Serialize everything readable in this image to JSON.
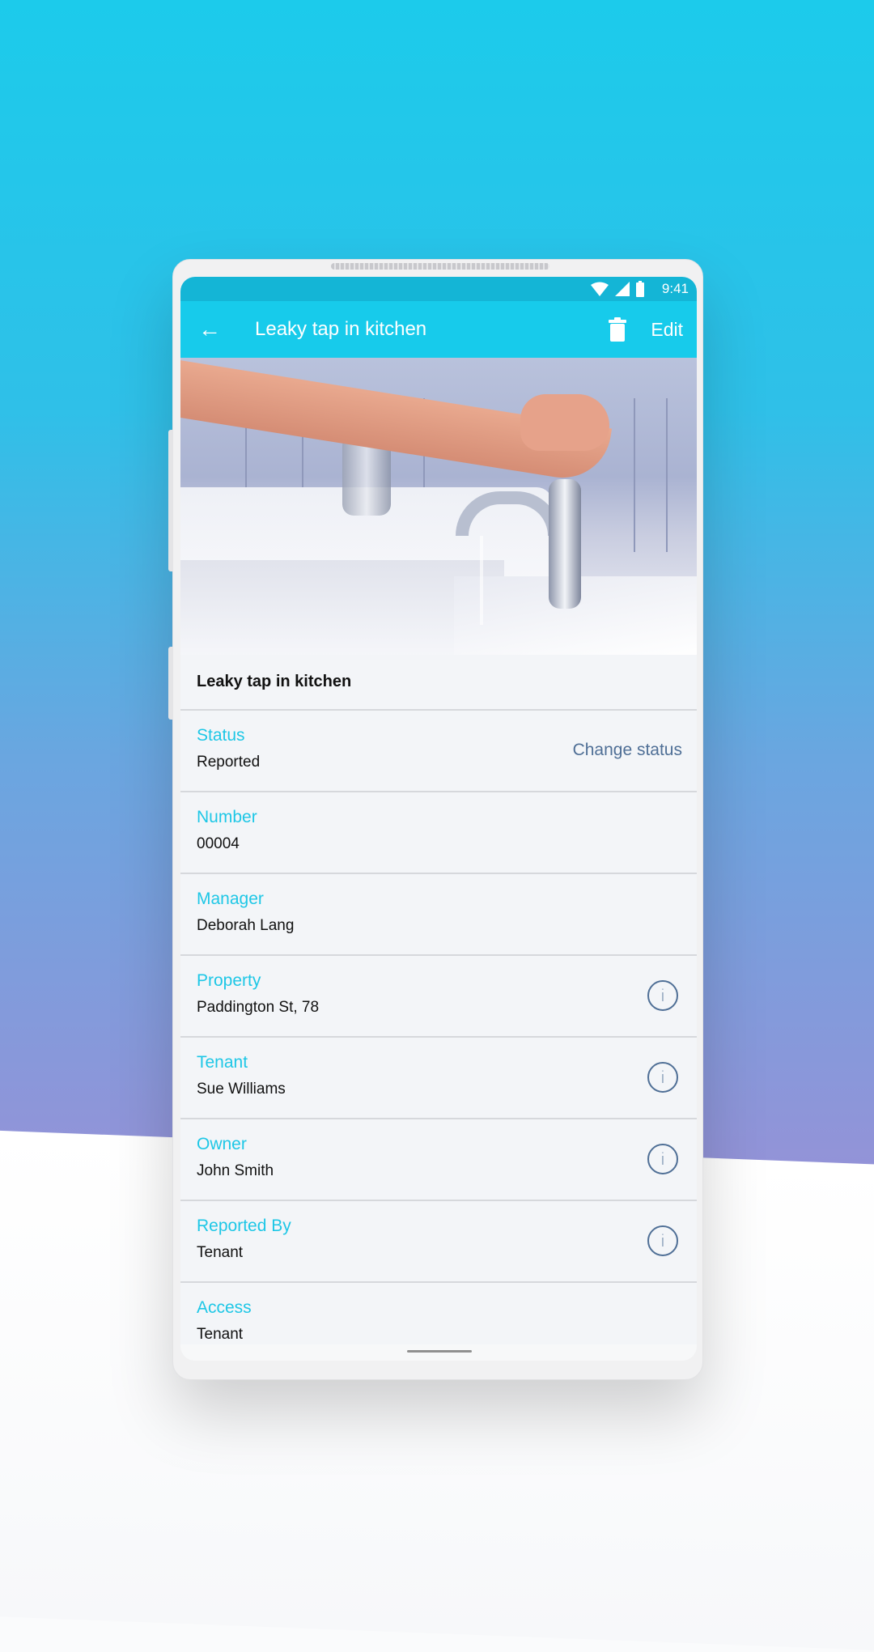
{
  "status_bar": {
    "time": "9:41"
  },
  "app_bar": {
    "title": "Leaky tap in kitchen",
    "edit_label": "Edit"
  },
  "detail": {
    "heading": "Leaky tap in kitchen",
    "rows": [
      {
        "label": "Status",
        "value": "Reported",
        "action": "Change status"
      },
      {
        "label": "Number",
        "value": "00004"
      },
      {
        "label": "Manager",
        "value": "Deborah Lang"
      },
      {
        "label": "Property",
        "value": "Paddington St, 78",
        "icon": "info-icon"
      },
      {
        "label": "Tenant",
        "value": "Sue Williams",
        "icon": "info-icon"
      },
      {
        "label": "Owner",
        "value": "John Smith",
        "icon": "info-icon"
      },
      {
        "label": "Reported By",
        "value": "Tenant",
        "icon": "info-icon"
      },
      {
        "label": "Access",
        "value": "Tenant"
      }
    ]
  },
  "colors": {
    "accent": "#17cbeb",
    "link": "#4f6f96"
  }
}
